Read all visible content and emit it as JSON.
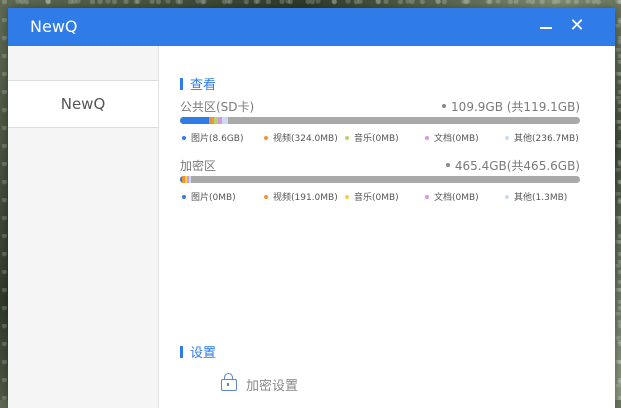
{
  "window": {
    "title": "NewQ",
    "minimize_icon": "minimize-icon",
    "close_glyph": "✕"
  },
  "sidebar": {
    "items": [
      {
        "label": "NewQ",
        "selected": true
      }
    ]
  },
  "view_section": {
    "title": "查看"
  },
  "volumes": [
    {
      "name": "公共区(SD卡)",
      "size": "109.9GB (共119.1GB)",
      "usage": [
        {
          "key": "pictures",
          "label": "图片(8.6GB)",
          "color": "#2f7be8",
          "fraction": 0.072
        },
        {
          "key": "video",
          "label": "视频(324.0MB)",
          "color": "#f0923a",
          "fraction": 0.012
        },
        {
          "key": "music",
          "label": "音乐(0MB)",
          "color": "#b7d36b",
          "fraction": 0.012
        },
        {
          "key": "docs",
          "label": "文档(0MB)",
          "color": "#d59ad8",
          "fraction": 0.01
        },
        {
          "key": "other",
          "label": "其他(236.7MB)",
          "color": "#c9dcf2",
          "fraction": 0.015
        }
      ]
    },
    {
      "name": "加密区",
      "size": "465.4GB(共465.6GB)",
      "usage": [
        {
          "key": "pictures",
          "label": "图片(0MB)",
          "color": "#2f7be8",
          "fraction": 0.006
        },
        {
          "key": "video",
          "label": "视频(191.0MB)",
          "color": "#f0923a",
          "fraction": 0.006
        },
        {
          "key": "music",
          "label": "音乐(0MB)",
          "color": "#f4d24a",
          "fraction": 0.006
        },
        {
          "key": "docs",
          "label": "文档(0MB)",
          "color": "#d59ad8",
          "fraction": 0.004
        },
        {
          "key": "other",
          "label": "其他(1.3MB)",
          "color": "#c9dcf2",
          "fraction": 0.006
        }
      ]
    }
  ],
  "settings_section": {
    "title": "设置",
    "items": [
      {
        "label": "加密设置",
        "icon": "lock-icon"
      }
    ]
  }
}
